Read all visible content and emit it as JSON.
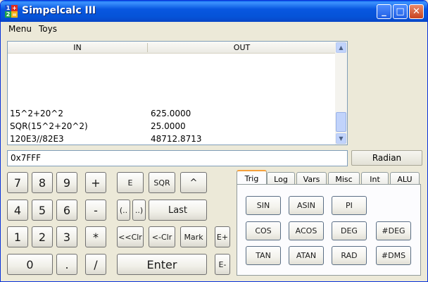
{
  "window": {
    "title": "Simpelcalc III",
    "icon_digits": [
      "1",
      "+",
      "2",
      "="
    ],
    "controls": {
      "minimize": "_",
      "maximize": "□",
      "close": "✕"
    }
  },
  "menu": [
    "Menu",
    "Toys"
  ],
  "output": {
    "columns": [
      "IN",
      "OUT"
    ],
    "rows": [
      {
        "in": "15^2+20^2",
        "out": "625.0000"
      },
      {
        "in": "SQR(15^2+20^2)",
        "out": "25.0000"
      },
      {
        "in": "120E3//82E3",
        "out": "48712.8713"
      }
    ],
    "scroll_up": "▲",
    "scroll_down": "▼"
  },
  "input": {
    "value": "0x7FFF"
  },
  "mode_button": "Radian",
  "keypad": {
    "digits": {
      "k7": "7",
      "k8": "8",
      "k9": "9",
      "k4": "4",
      "k5": "5",
      "k6": "6",
      "k1": "1",
      "k2": "2",
      "k3": "3",
      "k0": "0",
      "dot": "."
    },
    "ops": {
      "plus": "+",
      "minus": "-",
      "times": "*",
      "divide": "/"
    },
    "functions": {
      "e": "E",
      "sqr": "SQR",
      "pow": "^",
      "paren_open": "(..",
      "paren_close": "..)",
      "last": "Last",
      "clear_all": "<<Clr",
      "clear": "<-Clr",
      "mark": "Mark",
      "e_plus": "E+",
      "e_minus": "E-",
      "enter": "Enter"
    }
  },
  "tabs": [
    "Trig",
    "Log",
    "Vars",
    "Misc",
    "Int",
    "ALU"
  ],
  "active_tab": "Trig",
  "trig_buttons": {
    "sin": "SIN",
    "asin": "ASIN",
    "pi": "PI",
    "cos": "COS",
    "acos": "ACOS",
    "deg": "DEG",
    "hash_deg": "#DEG",
    "tan": "TAN",
    "atan": "ATAN",
    "rad": "RAD",
    "hash_dms": "#DMS"
  }
}
